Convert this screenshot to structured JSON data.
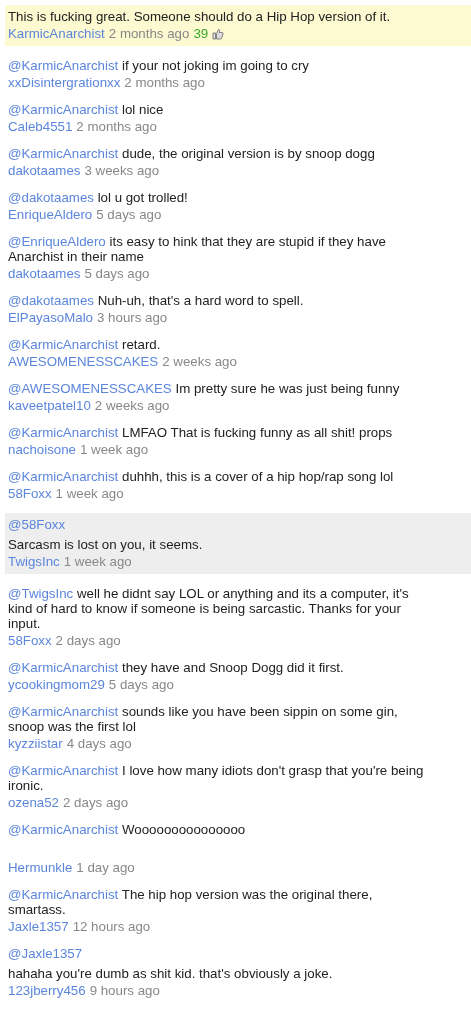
{
  "comments": [
    {
      "kind": "featured",
      "text": "This is fucking great. Someone should do a Hip Hop version of it.",
      "author": "KarmicAnarchist",
      "time": "2 months ago",
      "votes": "39"
    },
    {
      "kind": "plain",
      "mention": "@KarmicAnarchist",
      "text": "if your not joking im going to cry",
      "author": "xxDisintergrationxx",
      "time": "2 months ago"
    },
    {
      "kind": "plain",
      "mention": "@KarmicAnarchist",
      "text": "lol nice",
      "author": "Caleb4551",
      "time": "2 months ago"
    },
    {
      "kind": "plain",
      "mention": "@KarmicAnarchist",
      "text": "dude, the original version is by snoop dogg",
      "author": "dakotaames",
      "time": "3 weeks ago"
    },
    {
      "kind": "plain",
      "mention": "@dakotaames",
      "text": "lol u got trolled!",
      "author": "EnriqueAldero",
      "time": "5 days ago"
    },
    {
      "kind": "plain",
      "mention": "@EnriqueAldero",
      "text": "its easy to hink that they are stupid if they have Anarchist in their name",
      "author": "dakotaames",
      "time": "5 days ago"
    },
    {
      "kind": "plain",
      "mention": "@dakotaames",
      "text": "Nuh-uh, that's a hard word to spell.",
      "author": "ElPayasoMalo",
      "time": "3 hours ago"
    },
    {
      "kind": "plain",
      "mention": "@KarmicAnarchist",
      "text": "retard.",
      "author": "AWESOMENESSCAKES",
      "time": "2 weeks ago"
    },
    {
      "kind": "plain",
      "mention": "@AWESOMENESSCAKES",
      "text": "Im pretty sure he was just being funny",
      "author": "kaveetpatel10",
      "time": "2 weeks ago"
    },
    {
      "kind": "plain",
      "mention": "@KarmicAnarchist",
      "text": "LMFAO That is fucking funny as all shit! props",
      "author": "nachoisone",
      "time": "1 week ago"
    },
    {
      "kind": "plain",
      "mention": "@KarmicAnarchist",
      "text": "duhhh, this is a cover of a hip hop/rap song lol",
      "author": "58Foxx",
      "time": "1 week ago"
    },
    {
      "kind": "highlighted",
      "reply_to": "@58Foxx",
      "text": "Sarcasm is lost on you, it seems.",
      "author": "TwigsInc",
      "time": "1 week ago"
    },
    {
      "kind": "plain",
      "mention": "@TwigsInc",
      "text": "well he didnt say LOL or anything and its a computer, it's kind of hard to know if someone is being sarcastic. Thanks for your input.",
      "author": "58Foxx",
      "time": "2 days ago"
    },
    {
      "kind": "plain",
      "mention": "@KarmicAnarchist",
      "text": "they have and Snoop Dogg did it first.",
      "author": "ycookingmom29",
      "time": "5 days ago"
    },
    {
      "kind": "plain",
      "mention": "@KarmicAnarchist",
      "text": "sounds like you have been sippin on some gin, snoop was the first lol",
      "author": "kyzziistar",
      "time": "4 days ago"
    },
    {
      "kind": "plain",
      "mention": "@KarmicAnarchist",
      "text": "I love how many idiots don't grasp that you're being ironic.",
      "author": "ozena52",
      "time": "2 days ago"
    },
    {
      "kind": "plain",
      "mention": "@KarmicAnarchist",
      "text": "Wooooooooooooooo",
      "trailing_blank_line": true,
      "author": "Hermunkle",
      "time": "1 day ago"
    },
    {
      "kind": "plain",
      "mention": "@KarmicAnarchist",
      "text": "The hip hop version was the original there, smartass.",
      "author": "Jaxle1357",
      "time": "12 hours ago"
    },
    {
      "kind": "plain",
      "reply_to": "@Jaxle1357",
      "text": "hahaha you're dumb as shit kid. that's obviously a joke.",
      "author": "123jberry456",
      "time": "9 hours ago"
    }
  ]
}
